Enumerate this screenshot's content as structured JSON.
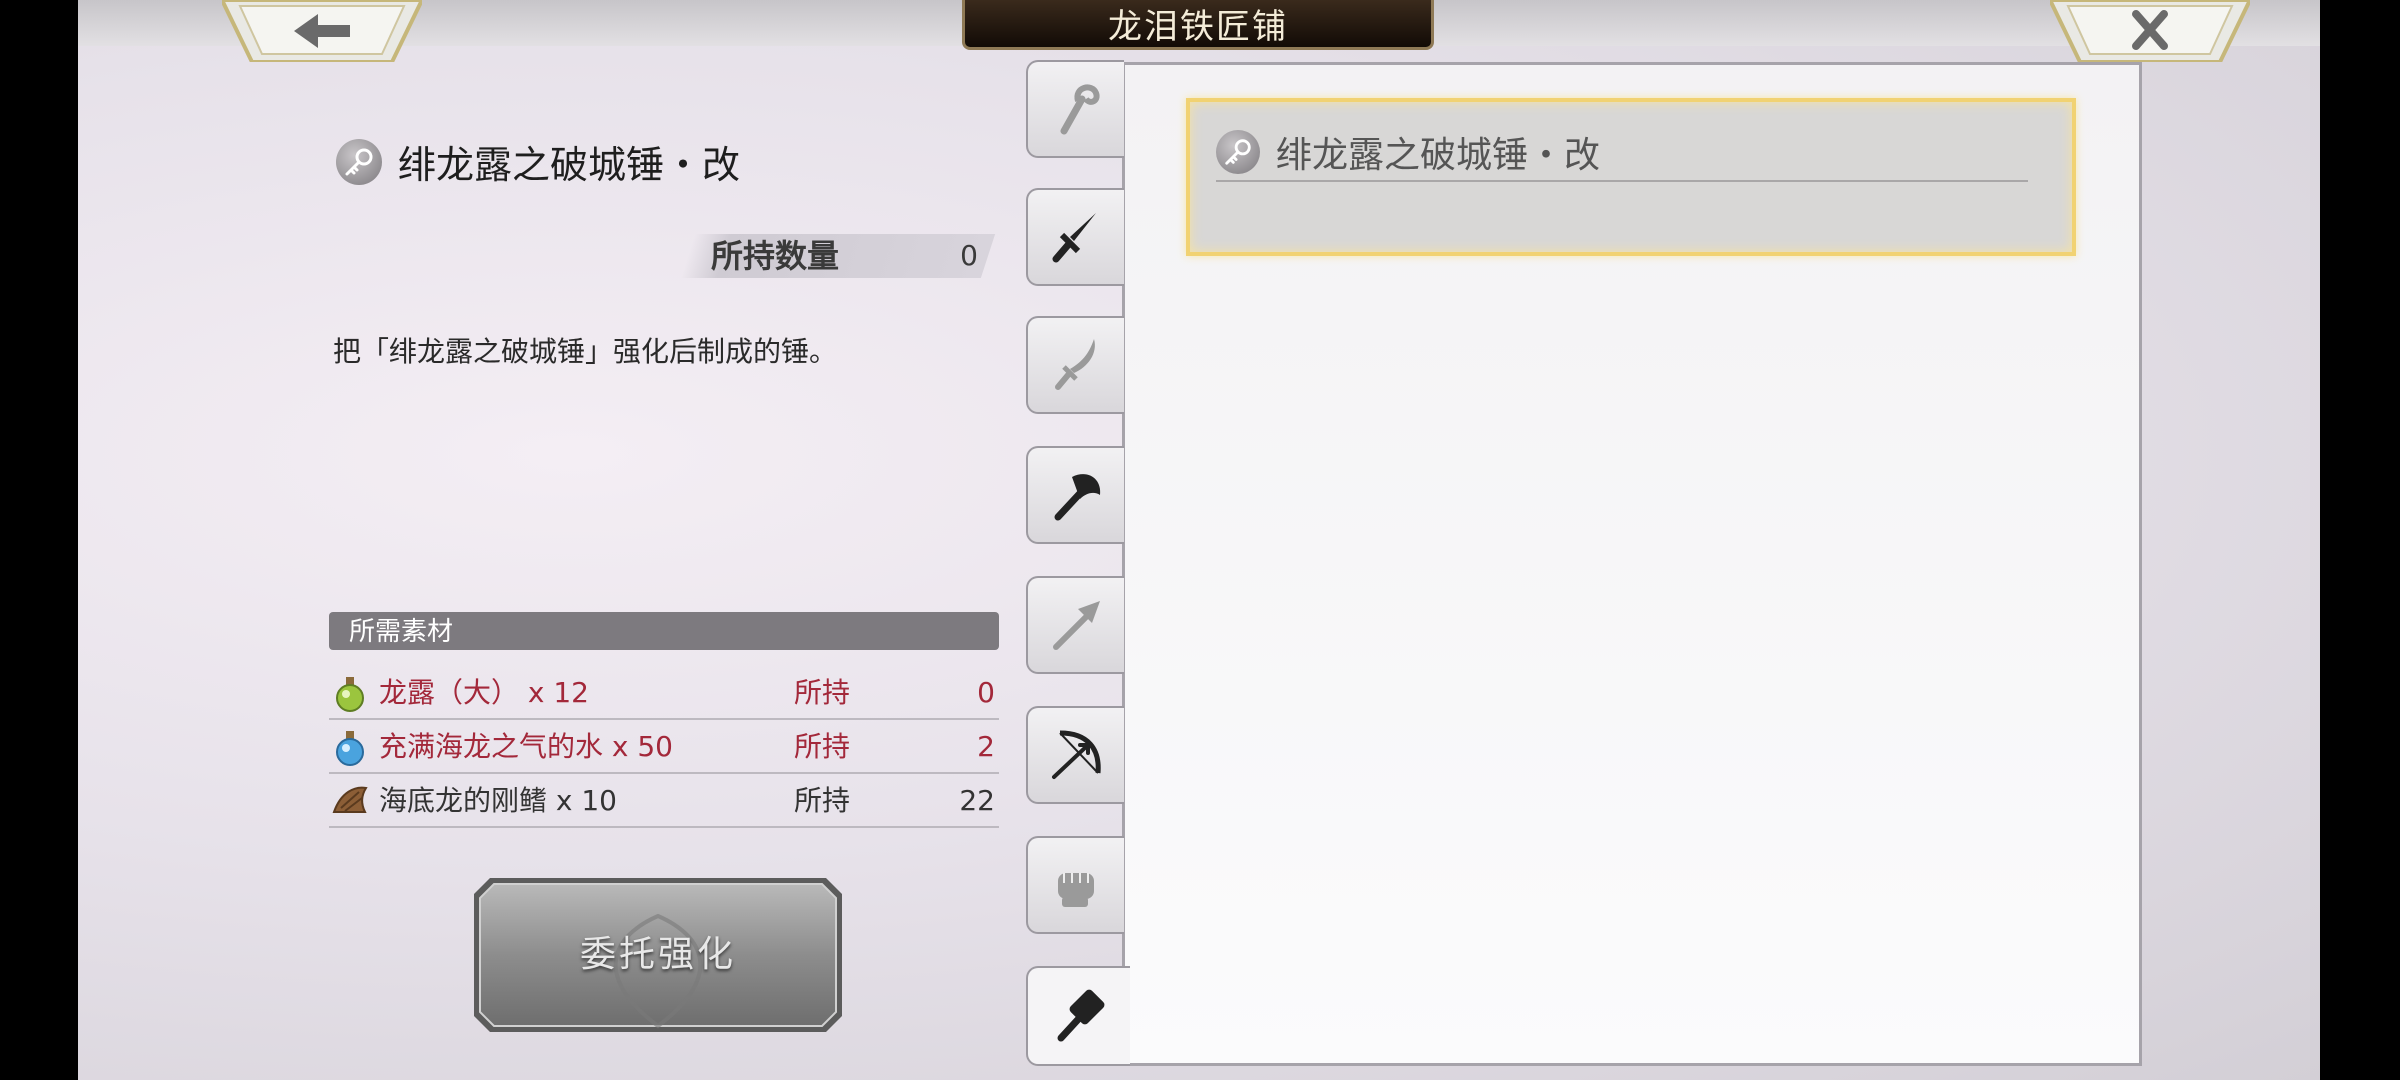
{
  "header": {
    "title": "龙泪铁匠铺"
  },
  "item": {
    "name": "绯龙露之破城锤・改",
    "owned_label": "所持数量",
    "owned_value": "0",
    "description": "把「绯龙露之破城锤」强化后制成的锤。"
  },
  "materials": {
    "header": "所需素材",
    "rows": [
      {
        "name": "龙露（大） x 12",
        "own_label": "所持",
        "own_value": "0",
        "icon": "green-potion-icon",
        "insufficient": true
      },
      {
        "name": "充满海龙之气的水 x 50",
        "own_label": "所持",
        "own_value": "2",
        "icon": "blue-potion-icon",
        "insufficient": true
      },
      {
        "name": "海底龙的刚鳍 x 10",
        "own_label": "所持",
        "own_value": "22",
        "icon": "fin-icon",
        "insufficient": false
      }
    ]
  },
  "action": {
    "commission_label": "委托强化"
  },
  "tabs": [
    {
      "name": "staff",
      "icon": "staff-icon",
      "active": false
    },
    {
      "name": "sword",
      "icon": "sword-icon",
      "active": false
    },
    {
      "name": "blade",
      "icon": "curved-blade-icon",
      "active": false
    },
    {
      "name": "axe",
      "icon": "axe-icon",
      "active": false
    },
    {
      "name": "spear",
      "icon": "spear-icon",
      "active": false
    },
    {
      "name": "bow",
      "icon": "bow-icon",
      "active": false
    },
    {
      "name": "fist",
      "icon": "fist-icon",
      "active": false
    },
    {
      "name": "hammer",
      "icon": "hammer-icon",
      "active": true
    }
  ],
  "list": {
    "items": [
      {
        "name": "绯龙露之破城锤・改",
        "selected": true
      }
    ]
  },
  "colors": {
    "insufficient": "#a3283a",
    "selection": "#f1d272",
    "title_plate": "#1f150c"
  }
}
